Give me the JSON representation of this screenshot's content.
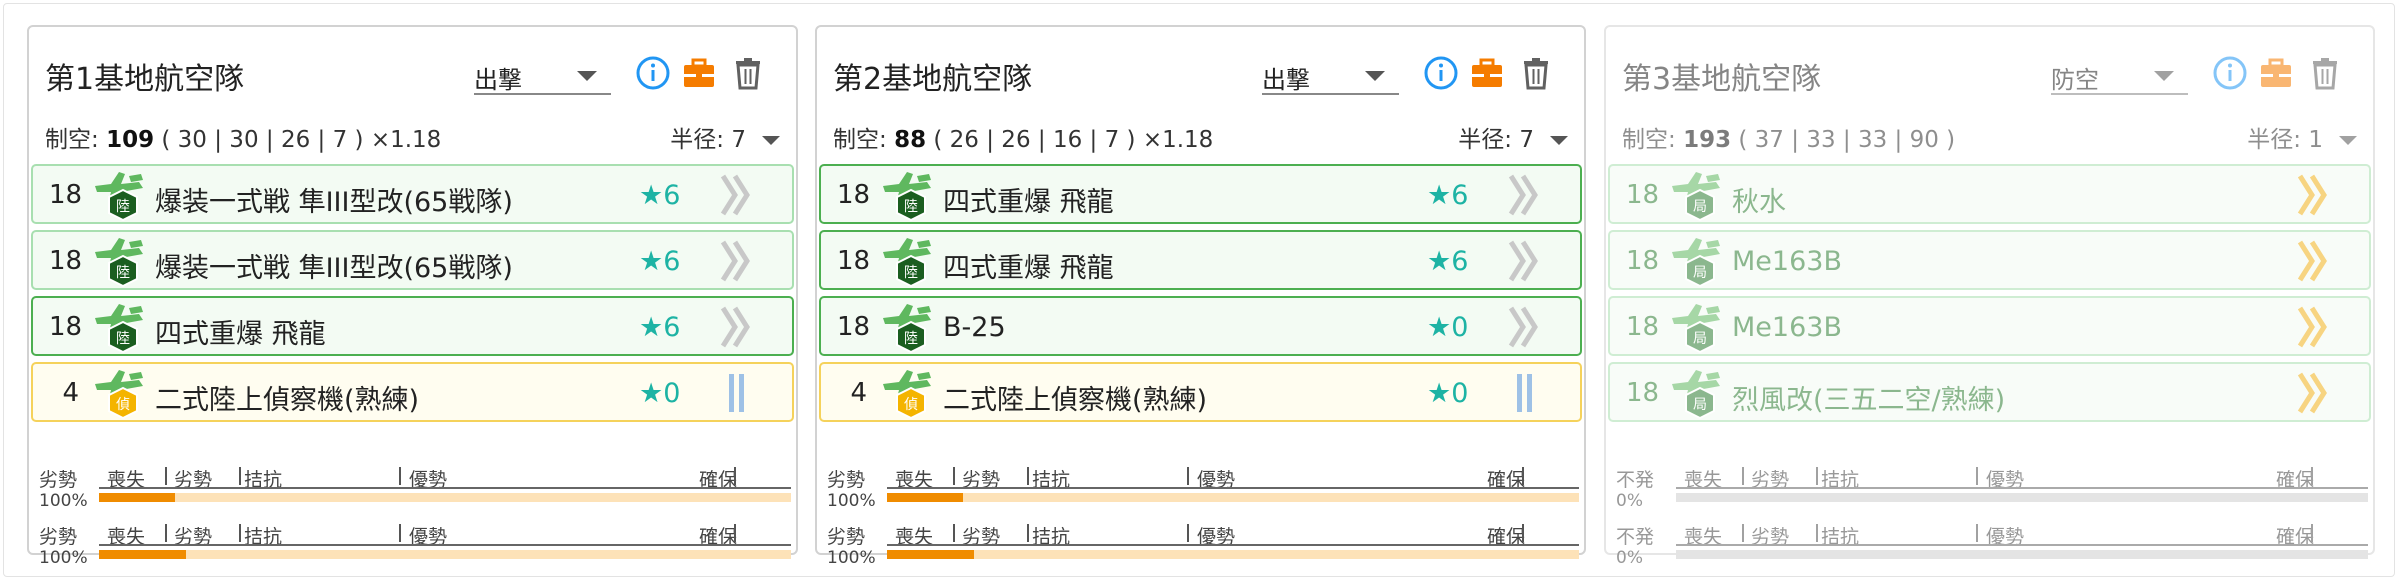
{
  "panels": [
    {
      "title": "第1基地航空隊",
      "mode": "出撃",
      "stats_label": "制空: ",
      "stats_value": "109",
      "stats_detail": " ( 30 | 30 | 26 | 7 ) ×1.18",
      "radius_label": "半径: ",
      "radius_value": "7",
      "slots": [
        {
          "count": "18",
          "name": "爆装一式戦 隼III型改(65戦隊)",
          "star": "★6",
          "badge": "陸",
          "type": "fighter",
          "prof": "chevron"
        },
        {
          "count": "18",
          "name": "爆装一式戦 隼III型改(65戦隊)",
          "star": "★6",
          "badge": "陸",
          "type": "fighter",
          "prof": "chevron"
        },
        {
          "count": "18",
          "name": "四式重爆 飛龍",
          "star": "★6",
          "badge": "陸",
          "type": "bomber",
          "prof": "chevron"
        },
        {
          "count": "4",
          "name": "二式陸上偵察機(熟練)",
          "star": "★0",
          "badge": "偵",
          "type": "recon",
          "prof": "bars"
        }
      ],
      "bars": [
        {
          "status": "劣勢",
          "pct": "100%",
          "fill": 0.11
        },
        {
          "status": "劣勢",
          "pct": "100%",
          "fill": 0.125
        }
      ]
    },
    {
      "title": "第2基地航空隊",
      "mode": "出撃",
      "stats_label": "制空: ",
      "stats_value": "88",
      "stats_detail": " ( 26 | 26 | 16 | 7 ) ×1.18",
      "radius_label": "半径: ",
      "radius_value": "7",
      "slots": [
        {
          "count": "18",
          "name": "四式重爆 飛龍",
          "star": "★6",
          "badge": "陸",
          "type": "bomber",
          "prof": "chevron"
        },
        {
          "count": "18",
          "name": "四式重爆 飛龍",
          "star": "★6",
          "badge": "陸",
          "type": "bomber",
          "prof": "chevron"
        },
        {
          "count": "18",
          "name": "B-25",
          "star": "★0",
          "badge": "陸",
          "type": "bomber",
          "prof": "chevron"
        },
        {
          "count": "4",
          "name": "二式陸上偵察機(熟練)",
          "star": "★0",
          "badge": "偵",
          "type": "recon",
          "prof": "bars"
        }
      ],
      "bars": [
        {
          "status": "劣勢",
          "pct": "100%",
          "fill": 0.11
        },
        {
          "status": "劣勢",
          "pct": "100%",
          "fill": 0.125
        }
      ]
    },
    {
      "title": "第3基地航空隊",
      "mode": "防空",
      "stats_label": "制空: ",
      "stats_value": "193",
      "stats_detail": " ( 37 | 33 | 33 | 90 )",
      "radius_label": "半径: ",
      "radius_value": "1",
      "slots": [
        {
          "count": "18",
          "name": "秋水",
          "star": "",
          "badge": "局",
          "type": "interceptor",
          "prof": "gold"
        },
        {
          "count": "18",
          "name": "Me163B",
          "star": "",
          "badge": "局",
          "type": "interceptor",
          "prof": "gold"
        },
        {
          "count": "18",
          "name": "Me163B",
          "star": "",
          "badge": "局",
          "type": "interceptor",
          "prof": "gold"
        },
        {
          "count": "18",
          "name": "烈風改(三五二空/熟練)",
          "star": "",
          "badge": "局",
          "type": "interceptor",
          "prof": "gold"
        }
      ],
      "bars": [
        {
          "status": "不発",
          "pct": "0%",
          "fill": 0
        },
        {
          "status": "不発",
          "pct": "0%",
          "fill": 0
        }
      ]
    }
  ],
  "scale_labels": [
    "喪失",
    "劣勢",
    "拮抗",
    "優勢",
    "確保"
  ],
  "colors": {
    "green_border": "#a8dfb0",
    "green_selected": "#4caf50",
    "recon_border": "#f5d25b",
    "star": "#1db3a4",
    "bar_fill": "#f08c00",
    "bar_track": "#fde2b8",
    "icon_blue": "#2196f3",
    "icon_orange": "#f57c00",
    "icon_gray": "#616161"
  },
  "icons": [
    "info-icon",
    "briefcase-icon",
    "trash-icon",
    "plane-icon",
    "chevron-right-icon",
    "proficiency-bars-icon"
  ]
}
